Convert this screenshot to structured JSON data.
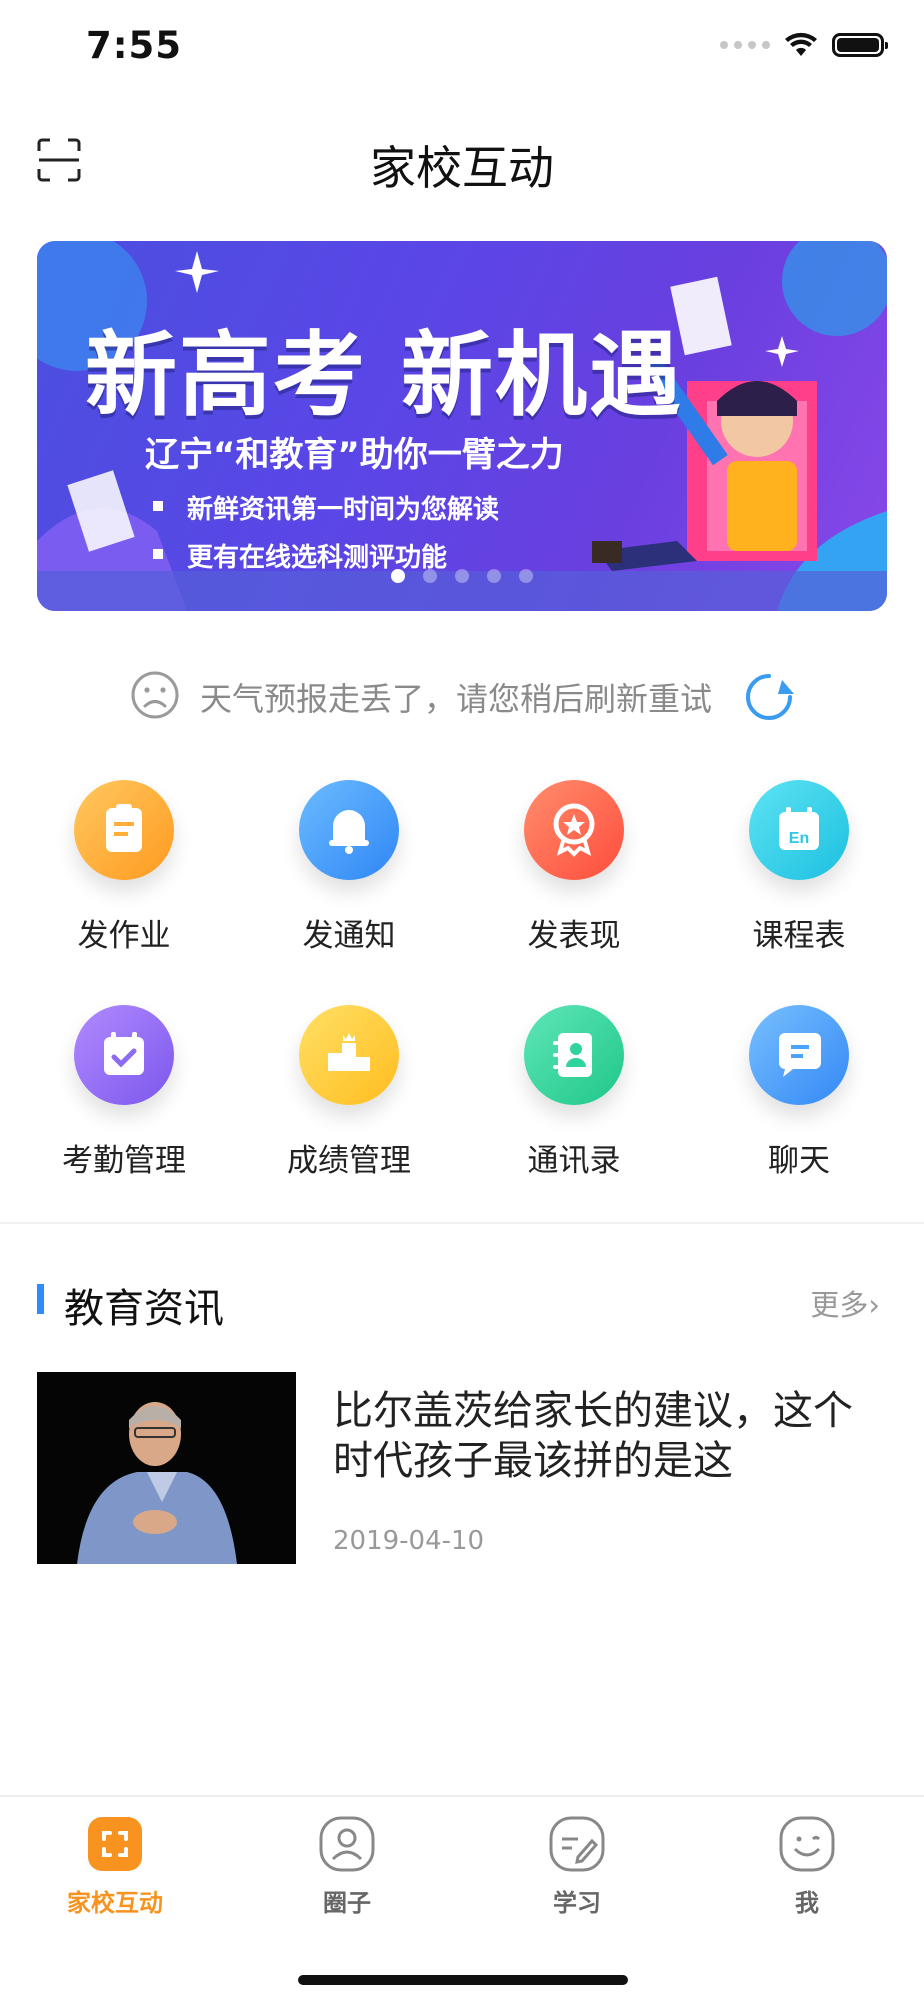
{
  "status_bar": {
    "time": "7:55"
  },
  "nav": {
    "title": "家校互动",
    "scan_icon": "scan-icon"
  },
  "banner": {
    "headline": "新高考 新机遇",
    "subtitle": "辽宁“和教育”助你一臂之力",
    "bullets": [
      "新鲜资讯第一时间为您解读",
      "更有在线选科测评功能"
    ],
    "dots": 5,
    "active_dot": 0
  },
  "weather": {
    "message": "天气预报走丢了，请您稍后刷新重试",
    "face_icon": "sad-face-icon",
    "refresh_icon": "refresh-icon"
  },
  "grid": {
    "items": [
      {
        "label": "发作业",
        "icon": "homework-icon",
        "color": "#ffb13b"
      },
      {
        "label": "发通知",
        "icon": "bell-icon",
        "color": "#3aa1ff"
      },
      {
        "label": "发表现",
        "icon": "medal-icon",
        "color": "#ff6a4f"
      },
      {
        "label": "课程表",
        "icon": "calendar-en-icon",
        "color": "#2fd0e8"
      },
      {
        "label": "考勤管理",
        "icon": "calendar-check-icon",
        "color": "#9a6cf5"
      },
      {
        "label": "成绩管理",
        "icon": "podium-icon",
        "color": "#ffcc2f"
      },
      {
        "label": "通讯录",
        "icon": "contacts-icon",
        "color": "#2fd39c"
      },
      {
        "label": "聊天",
        "icon": "chat-icon",
        "color": "#4aa3ff"
      }
    ]
  },
  "news": {
    "section_title": "教育资讯",
    "more_label": "更多",
    "items": [
      {
        "title": "比尔盖茨给家长的建议，这个时代孩子最该拼的是这",
        "date": "2019-04-10"
      }
    ]
  },
  "tabbar": {
    "items": [
      {
        "label": "家校互动",
        "icon": "home-school-icon",
        "active": true
      },
      {
        "label": "圈子",
        "icon": "profile-circle-icon",
        "active": false
      },
      {
        "label": "学习",
        "icon": "edit-note-icon",
        "active": false
      },
      {
        "label": "我",
        "icon": "smile-icon",
        "active": false
      }
    ],
    "active_color": "#f7931e",
    "inactive_color": "#666666"
  }
}
